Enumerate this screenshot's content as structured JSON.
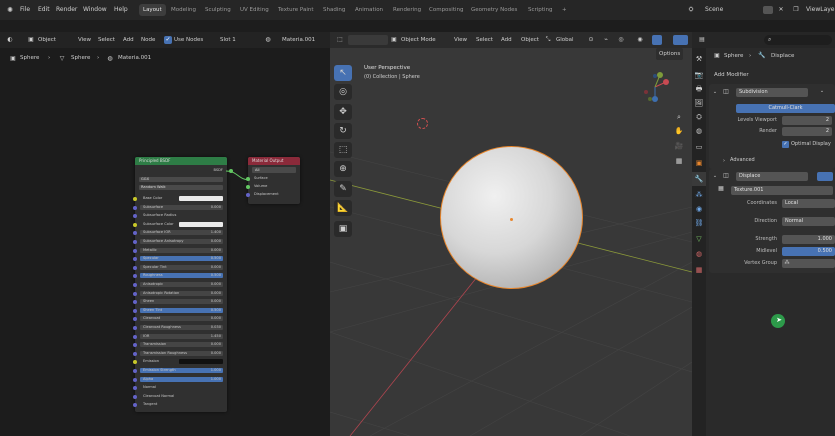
{
  "topbar": {
    "menus": [
      "File",
      "Edit",
      "Render",
      "Window",
      "Help"
    ],
    "workspaces": [
      "Layout",
      "Modeling",
      "Sculpting",
      "UV Editing",
      "Texture Paint",
      "Shading",
      "Animation",
      "Rendering",
      "Compositing",
      "Geometry Nodes",
      "Scripting"
    ],
    "add_tab": "+",
    "scene": "Scene",
    "view_layer": "ViewLayer"
  },
  "node_editor": {
    "object_mode": "Object",
    "menus": [
      "View",
      "Select",
      "Add",
      "Node"
    ],
    "use_nodes_label": "Use Nodes",
    "slot": "Slot 1",
    "material": "Materia.001",
    "breadcrumb": [
      "Sphere",
      "Sphere",
      "Materia.001"
    ],
    "bsdf": {
      "title": "Principled BSDF",
      "output": "BSDF",
      "dropdowns": [
        "GGX",
        "Random Walk"
      ],
      "inputs": [
        {
          "label": "Base Color",
          "value": ""
        },
        {
          "label": "Subsurface",
          "value": "0.000"
        },
        {
          "label": "Subsurface Radius",
          "value": ""
        },
        {
          "label": "Subsurface Color",
          "value": ""
        },
        {
          "label": "Subsurface IOR",
          "value": "1.400"
        },
        {
          "label": "Subsurface Anisotropy",
          "value": "0.000"
        },
        {
          "label": "Metallic",
          "value": "0.000"
        },
        {
          "label": "Specular",
          "value": "0.500"
        },
        {
          "label": "Specular Tint",
          "value": "0.000"
        },
        {
          "label": "Roughness",
          "value": "0.500"
        },
        {
          "label": "Anisotropic",
          "value": "0.000"
        },
        {
          "label": "Anisotropic Rotation",
          "value": "0.000"
        },
        {
          "label": "Sheen",
          "value": "0.000"
        },
        {
          "label": "Sheen Tint",
          "value": "0.500"
        },
        {
          "label": "Clearcoat",
          "value": "0.000"
        },
        {
          "label": "Clearcoat Roughness",
          "value": "0.030"
        },
        {
          "label": "IOR",
          "value": "1.450"
        },
        {
          "label": "Transmission",
          "value": "0.000"
        },
        {
          "label": "Transmission Roughness",
          "value": "0.000"
        },
        {
          "label": "Emission",
          "value": ""
        },
        {
          "label": "Emission Strength",
          "value": "1.000"
        },
        {
          "label": "Alpha",
          "value": "1.000"
        },
        {
          "label": "Normal",
          "value": ""
        },
        {
          "label": "Clearcoat Normal",
          "value": ""
        },
        {
          "label": "Tangent",
          "value": ""
        }
      ]
    },
    "output_node": {
      "title": "Material Output",
      "target": "All",
      "inputs": [
        "Surface",
        "Volume",
        "Displacement"
      ]
    }
  },
  "viewport": {
    "mode": "Object Mode",
    "menus": [
      "View",
      "Select",
      "Add",
      "Object"
    ],
    "orientation": "Global",
    "options_label": "Options",
    "overlay_title": "User Perspective",
    "overlay_sub": "(0) Collection | Sphere"
  },
  "properties": {
    "search_placeholder": "",
    "breadcrumb": [
      "Sphere",
      "Displace"
    ],
    "add_modifier": "Add Modifier",
    "subdivision": {
      "name": "Subdivision",
      "method": "Catmull-Clark",
      "levels_viewport_label": "Levels Viewport",
      "levels_viewport": "2",
      "render_label": "Render",
      "render": "2",
      "optimal_display": "Optimal Display",
      "advanced": "Advanced"
    },
    "displace": {
      "name": "Displace",
      "texture": "Texture.001",
      "coordinates_label": "Coordinates",
      "coordinates": "Local",
      "direction_label": "Direction",
      "direction": "Normal",
      "strength_label": "Strength",
      "strength": "1.000",
      "midlevel_label": "Midlevel",
      "midlevel": "0.500",
      "vertex_group_label": "Vertex Group"
    }
  }
}
